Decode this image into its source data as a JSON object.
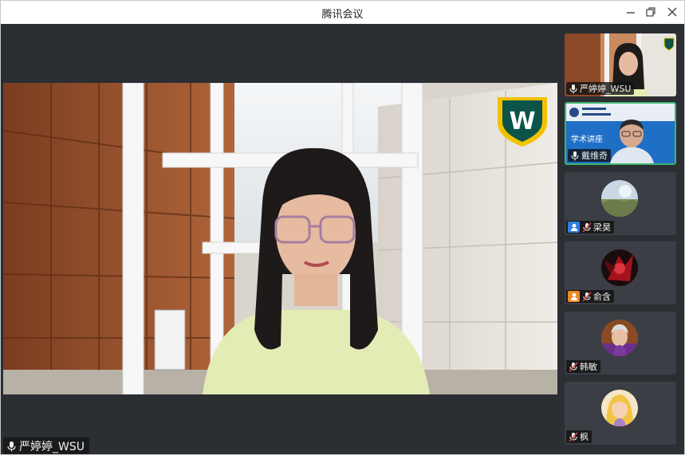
{
  "window": {
    "title": "腾讯会议"
  },
  "main_speaker": {
    "name": "严婷婷_WSU"
  },
  "participants": [
    {
      "name": "严婷婷_WSU",
      "mic": "on",
      "badge": "none"
    },
    {
      "name": "戴维奇",
      "mic": "on",
      "badge": "none",
      "slide_text": "学术讲座"
    },
    {
      "name": "梁昊",
      "mic": "muted",
      "badge": "user-icon"
    },
    {
      "name": "俞含",
      "mic": "muted",
      "badge": "user-icon"
    },
    {
      "name": "韩敏",
      "mic": "muted",
      "badge": "none"
    },
    {
      "name": "枫",
      "mic": "muted",
      "badge": "none"
    }
  ],
  "colors": {
    "active_speaker_border": "#3fb56f",
    "background": "#2b2e33",
    "mute_red": "#e23b3b"
  }
}
